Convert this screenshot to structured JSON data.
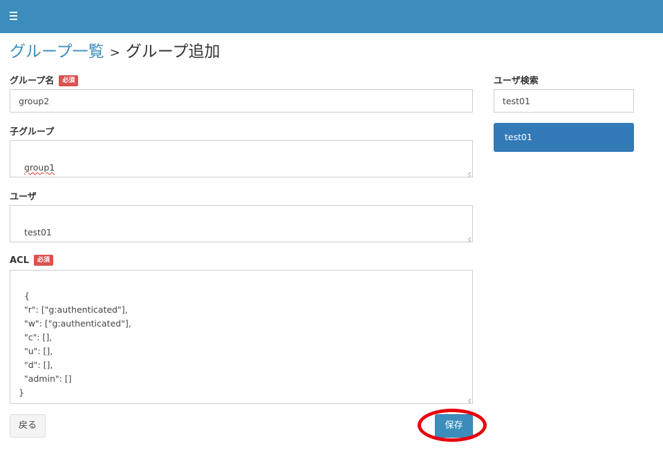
{
  "header": {
    "menu_icon": "hamburger-menu-icon"
  },
  "breadcrumb": {
    "parent": "グループ一覧",
    "separator": ">",
    "current": "グループ追加"
  },
  "form": {
    "required_badge": "必須",
    "group_name": {
      "label": "グループ名",
      "value": "group2"
    },
    "child_group": {
      "label": "子グループ",
      "value": "group1"
    },
    "user": {
      "label": "ユーザ",
      "value": "test01"
    },
    "acl": {
      "label": "ACL",
      "value": "{\n  \"r\": [\"g:authenticated\"],\n  \"w\": [\"g:authenticated\"],\n  \"c\": [],\n  \"u\": [],\n  \"d\": [],\n  \"admin\": []\n}"
    }
  },
  "user_search": {
    "label": "ユーザ検索",
    "value": "test01",
    "results": [
      "test01"
    ]
  },
  "buttons": {
    "back": "戻る",
    "save": "保存"
  },
  "colors": {
    "header": "#3c8dbc",
    "required_badge": "#d9534f",
    "selected_result": "#337ab7",
    "highlight": "#e8000b"
  }
}
